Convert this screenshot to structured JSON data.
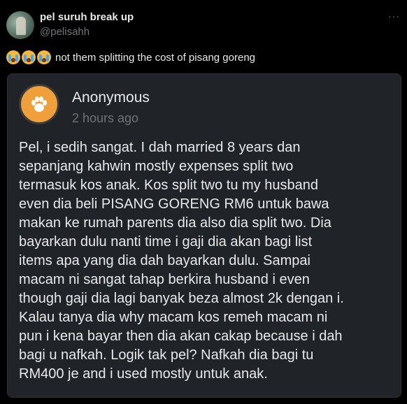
{
  "tweet": {
    "display_name": "pel suruh break up",
    "handle": "@pelisahh",
    "more_icon": "···",
    "emojis": [
      "loudly-crying-face",
      "loudly-crying-face",
      "loudly-crying-face"
    ],
    "text": "not them splitting the cost of pisang goreng"
  },
  "card": {
    "author": "Anonymous",
    "time": "2 hours ago",
    "avatar_icon": "paw-icon",
    "avatar_color": "#f0a03a",
    "body": "Pel, i sedih sangat. I dah married 8 years dan\nsepanjang kahwin mostly expenses split two\ntermasuk kos anak. Kos split two tu my husband\neven dia beli PISANG GORENG RM6 untuk bawa\nmakan ke rumah parents dia also dia split two. Dia\nbayarkan dulu nanti time i gaji dia akan bagi list\nitems apa yang dia dah bayarkan dulu. Sampai\nmacam ni sangat tahap berkira husband i even\nthough gaji dia lagi banyak beza almost 2k dengan i.\nKalau tanya dia why macam kos remeh macam ni\npun i kena bayar then dia akan cakap because i dah\nbagi u nafkah. Logik tak pel? Nafkah dia bagi tu\nRM400 je and i used mostly untuk anak."
  }
}
